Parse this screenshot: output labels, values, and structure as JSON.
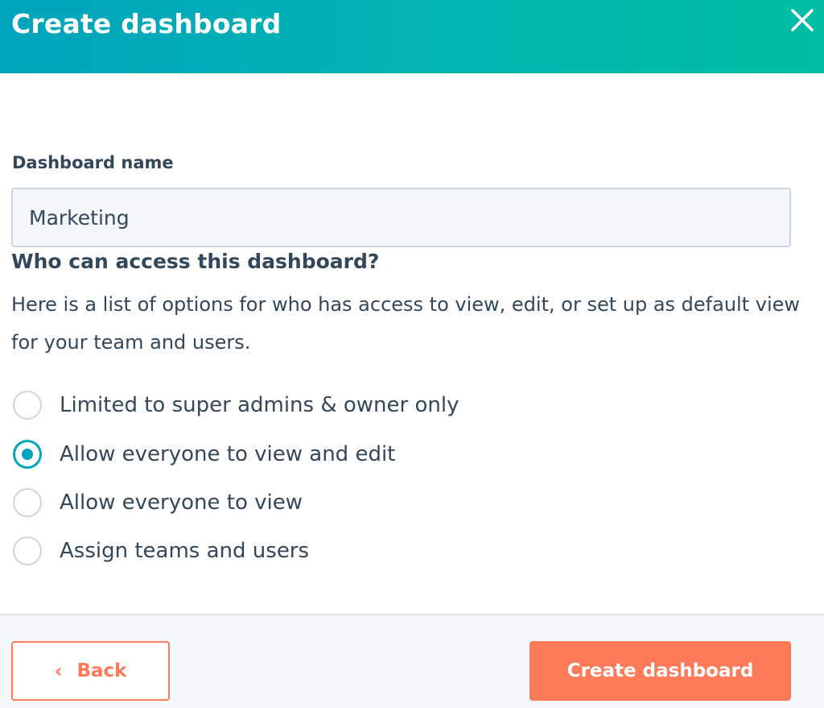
{
  "header": {
    "title": "Create dashboard",
    "close_icon": "close-icon"
  },
  "form": {
    "name_label": "Dashboard name",
    "name_value": "Marketing",
    "access_title": "Who can access this dashboard?",
    "access_description": "Here is a list of options for who has access to view, edit, or set up as default view for your team and users.",
    "options": [
      {
        "label": "Limited to super admins & owner only",
        "checked": false
      },
      {
        "label": "Allow everyone to view and edit",
        "checked": true
      },
      {
        "label": "Allow everyone to view",
        "checked": false
      },
      {
        "label": "Assign teams and users",
        "checked": false
      }
    ]
  },
  "footer": {
    "back_label": "Back",
    "back_icon": "chevron-left-icon",
    "create_label": "Create dashboard"
  },
  "colors": {
    "header_gradient_start": "#00a4bd",
    "header_gradient_end": "#00bda5",
    "accent": "#00a4bd",
    "primary_button": "#ff7a59",
    "text": "#33475b"
  }
}
